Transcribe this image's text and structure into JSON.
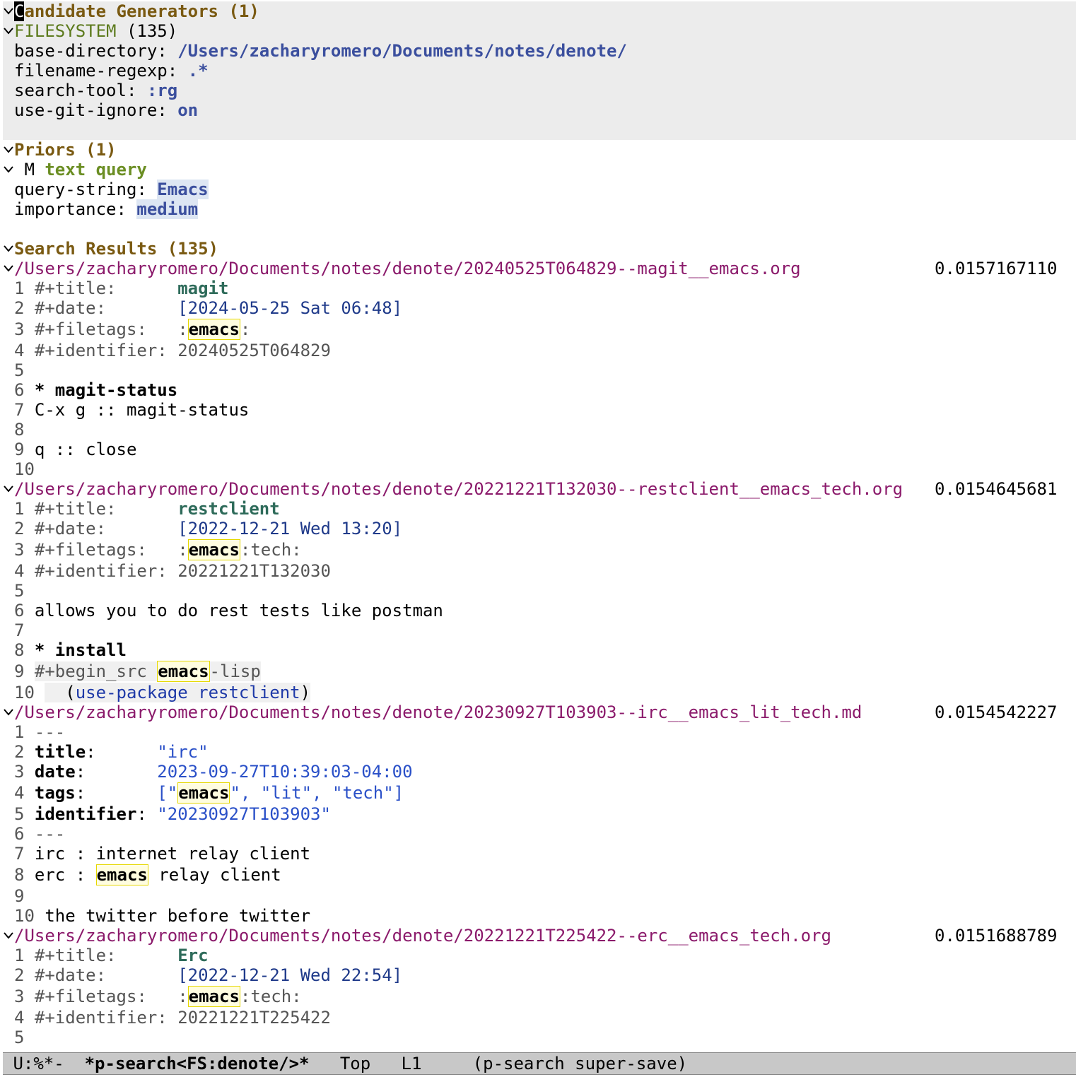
{
  "candidate_generators": {
    "header": "andidate Generators (1)",
    "cursor_char": "C",
    "generator_name": "FILESYSTEM",
    "generator_count": "(135)",
    "options": [
      {
        "key": "base-directory: ",
        "value": "/Users/zacharyromero/Documents/notes/denote/"
      },
      {
        "key": "filename-regexp: ",
        "value": ".*"
      },
      {
        "key": "search-tool: ",
        "value": ":rg"
      },
      {
        "key": "use-git-ignore: ",
        "value": "on"
      }
    ]
  },
  "priors": {
    "header": "Priors (1)",
    "marker": " M ",
    "name": "text query",
    "query_key": "query-string: ",
    "query_value": "Emacs",
    "importance_key": "importance: ",
    "importance_value": "medium"
  },
  "results": {
    "header": "Search Results (135)",
    "items": [
      {
        "path": "/Users/zacharyromero/Documents/notes/denote/20240525T064829--magit__emacs.org",
        "score": "0.0157167110",
        "lines": {
          "n1": "1 ",
          "k1": "#+title:      ",
          "v1": "magit",
          "n2": "2 ",
          "k2": "#+date:       ",
          "v2": "[2024-05-25 Sat 06:48]",
          "n3": "3 ",
          "k3": "#+filetags:   ",
          "t3a": ":",
          "m3": "emacs",
          "t3b": ":",
          "n4": "4 ",
          "k4": "#+identifier: ",
          "v4": "20240525T064829",
          "n5": "5 ",
          "n6": "6 ",
          "v6": "* magit-status",
          "n7": "7 ",
          "v7": "C-x g :: magit-status",
          "n8": "8 ",
          "n9": "9 ",
          "v9": "q :: close",
          "n10": "10 "
        }
      },
      {
        "path": "/Users/zacharyromero/Documents/notes/denote/20221221T132030--restclient__emacs_tech.org",
        "score": "0.0154645681",
        "lines": {
          "n1": "1 ",
          "k1": "#+title:      ",
          "v1": "restclient",
          "n2": "2 ",
          "k2": "#+date:       ",
          "v2": "[2022-12-21 Wed 13:20]",
          "n3": "3 ",
          "k3": "#+filetags:   ",
          "t3a": ":",
          "m3": "emacs",
          "t3b": ":tech:",
          "n4": "4 ",
          "k4": "#+identifier: ",
          "v4": "20221221T132030",
          "n5": "5 ",
          "n6": "6 ",
          "v6": "allows you to do rest tests like postman",
          "n7": "7 ",
          "n8": "8 ",
          "v8": "* install",
          "n9": "9 ",
          "k9": "#+begin_src ",
          "m9": "emacs",
          "t9": "-lisp",
          "n10": "10 ",
          "p10a": "  (",
          "f10a": "use-package",
          "s10": " ",
          "f10b": "restclient",
          "p10b": ")"
        }
      },
      {
        "path": "/Users/zacharyromero/Documents/notes/denote/20230927T103903--irc__emacs_lit_tech.md",
        "score": "0.0154542227",
        "lines": {
          "n1": "1 ",
          "v1": "---",
          "n2": "2 ",
          "k2": "title",
          "c2": ":      ",
          "v2": "\"irc\"",
          "n3": "3 ",
          "k3": "date",
          "c3": ":       ",
          "v3": "2023-09-27T10:39:03-04:00",
          "n4": "4 ",
          "k4": "tags",
          "c4": ":       ",
          "t4a": "[\"",
          "m4": "emacs",
          "t4b": "\", \"lit\", \"tech\"]",
          "n5": "5 ",
          "k5": "identifier",
          "c5": ": ",
          "v5": "\"20230927T103903\"",
          "n6": "6 ",
          "v6": "---",
          "n7": "7 ",
          "v7": "irc : internet relay client",
          "n8": "8 ",
          "t8a": "erc : ",
          "m8": "emacs",
          "t8b": " relay client",
          "n9": "9 ",
          "n10": "10 ",
          "v10": "the twitter before twitter"
        }
      },
      {
        "path": "/Users/zacharyromero/Documents/notes/denote/20221221T225422--erc__emacs_tech.org",
        "score": "0.0151688789",
        "lines": {
          "n1": "1 ",
          "k1": "#+title:      ",
          "v1": "Erc",
          "n2": "2 ",
          "k2": "#+date:       ",
          "v2": "[2022-12-21 Wed 22:54]",
          "n3": "3 ",
          "k3": "#+filetags:   ",
          "t3a": ":",
          "m3": "emacs",
          "t3b": ":tech:",
          "n4": "4 ",
          "k4": "#+identifier: ",
          "v4": "20221221T225422",
          "n5": "5 "
        }
      }
    ]
  },
  "modeline": {
    "state": " U:%*-  ",
    "buffer": "*p-search<FS:denote/>*",
    "position": "   Top   L1     ",
    "mode": "(p-search super-save)"
  },
  "icons": {
    "fold": "chevron-down-icon"
  }
}
